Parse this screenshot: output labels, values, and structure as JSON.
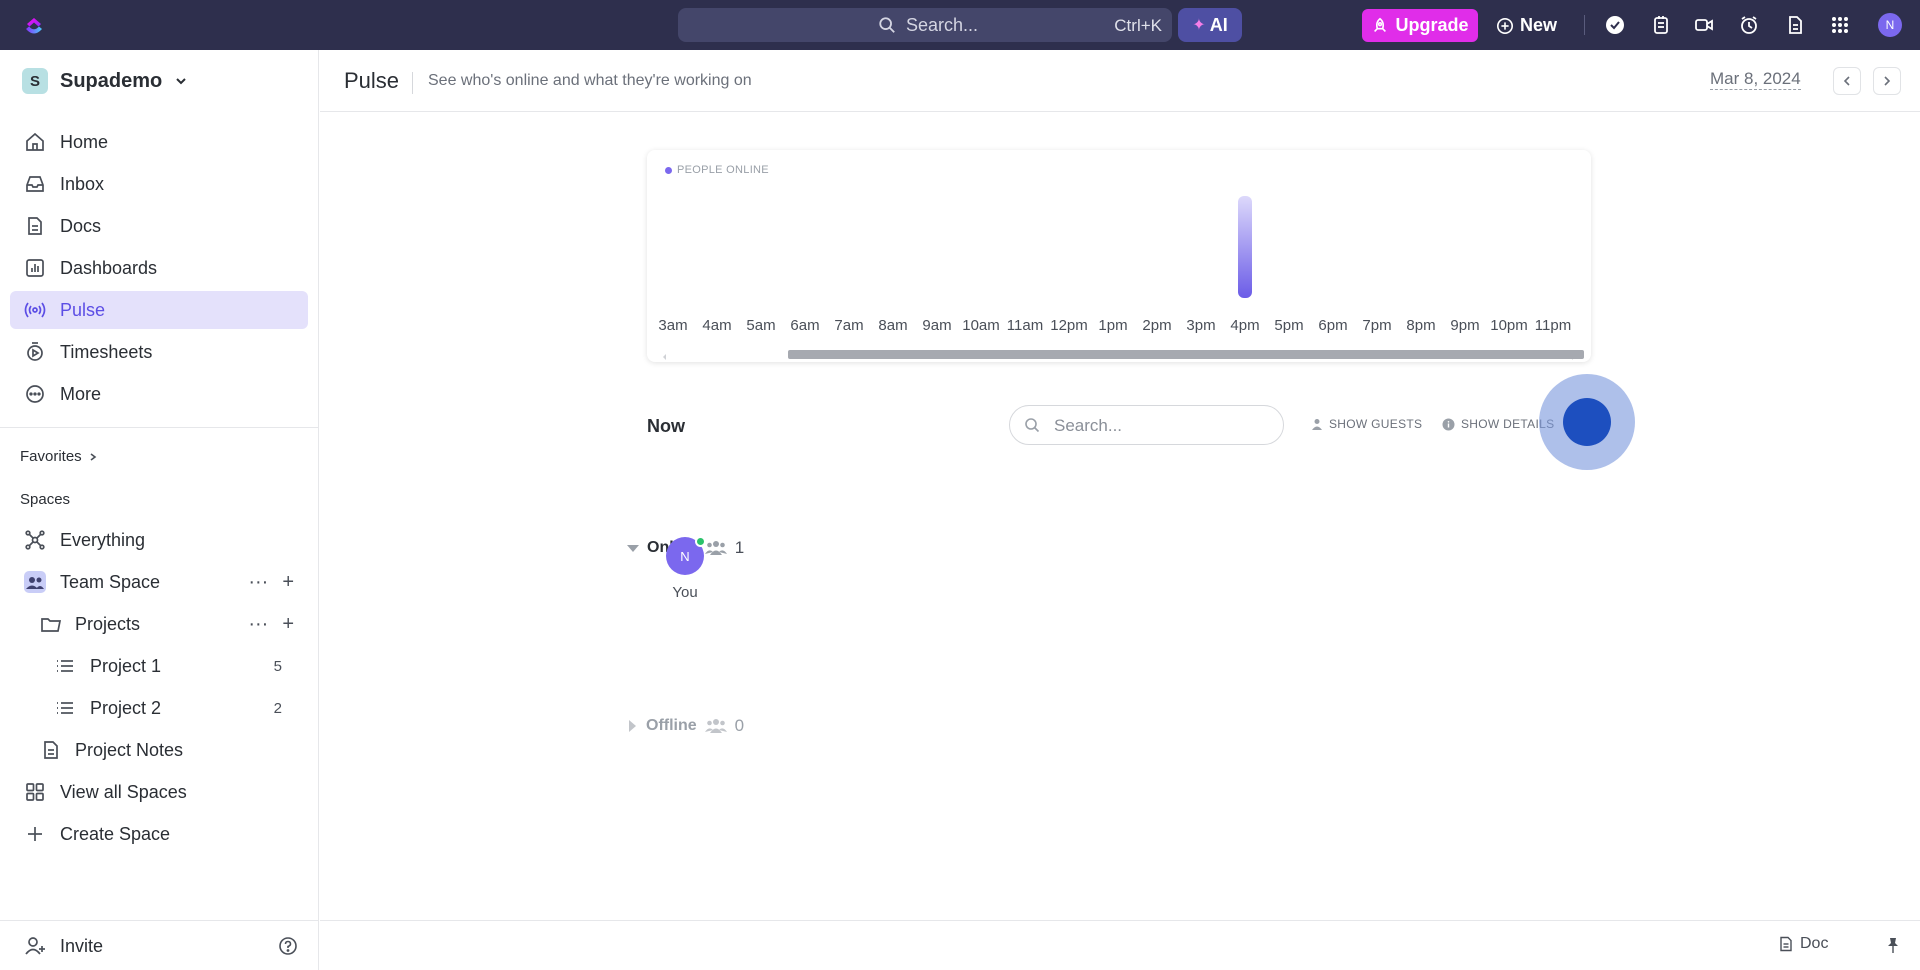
{
  "topbar": {
    "search_placeholder": "Search...",
    "search_shortcut": "Ctrl+K",
    "ai_label": "AI",
    "upgrade_label": "Upgrade",
    "new_label": "New",
    "avatar_initial": "N",
    "icons": [
      "check-circle-icon",
      "notepad-icon",
      "video-icon",
      "alarm-clock-icon",
      "document-icon",
      "apps-grid-icon"
    ]
  },
  "sidebar": {
    "workspace": {
      "initial": "S",
      "name": "Supademo"
    },
    "nav": [
      {
        "label": "Home",
        "icon": "home-icon"
      },
      {
        "label": "Inbox",
        "icon": "inbox-icon"
      },
      {
        "label": "Docs",
        "icon": "docs-icon"
      },
      {
        "label": "Dashboards",
        "icon": "dashboards-icon"
      },
      {
        "label": "Pulse",
        "icon": "pulse-icon",
        "active": true
      },
      {
        "label": "Timesheets",
        "icon": "timesheets-icon"
      },
      {
        "label": "More",
        "icon": "more-icon"
      }
    ],
    "favorites_label": "Favorites",
    "spaces_label": "Spaces",
    "spaces": {
      "everything": "Everything",
      "team_space": "Team Space",
      "projects": "Projects",
      "project_1": {
        "label": "Project 1",
        "count": "5"
      },
      "project_2": {
        "label": "Project 2",
        "count": "2"
      },
      "project_notes": "Project Notes",
      "view_all": "View all Spaces",
      "create": "Create Space"
    },
    "invite_label": "Invite"
  },
  "header": {
    "title": "Pulse",
    "subtitle": "See who's online and what they're working on",
    "date": "Mar 8, 2024"
  },
  "chart_data": {
    "type": "bar",
    "legend": "PEOPLE ONLINE",
    "categories": [
      "3am",
      "4am",
      "5am",
      "6am",
      "7am",
      "8am",
      "9am",
      "10am",
      "11am",
      "12pm",
      "1pm",
      "2pm",
      "3pm",
      "4pm",
      "5pm",
      "6pm",
      "7pm",
      "8pm",
      "9pm",
      "10pm",
      "11pm"
    ],
    "series": [
      {
        "values": [
          0,
          0,
          0,
          0,
          0,
          0,
          0,
          0,
          0,
          0,
          0,
          0,
          0,
          1,
          0,
          0,
          0,
          0,
          0,
          0,
          0
        ]
      }
    ],
    "ylim": [
      0,
      1
    ],
    "colors": {
      "bar_top": "#ddd9fb",
      "bar_bottom": "#6b5ce7"
    },
    "grid": false
  },
  "now": {
    "label": "Now",
    "search_placeholder": "Search...",
    "show_guests": "SHOW GUESTS",
    "show_details": "SHOW DETAILS"
  },
  "groups": {
    "online": {
      "label": "Online",
      "count": "1"
    },
    "offline": {
      "label": "Offline",
      "count": "0"
    },
    "members": [
      {
        "initial": "N",
        "name": "You",
        "status": "online"
      }
    ]
  },
  "footer": {
    "doc_label": "Doc"
  },
  "colors": {
    "accent": "#7b68ee",
    "topbar": "#2e2f4d",
    "upgrade": "#e02de9",
    "online": "#2bc26b"
  }
}
